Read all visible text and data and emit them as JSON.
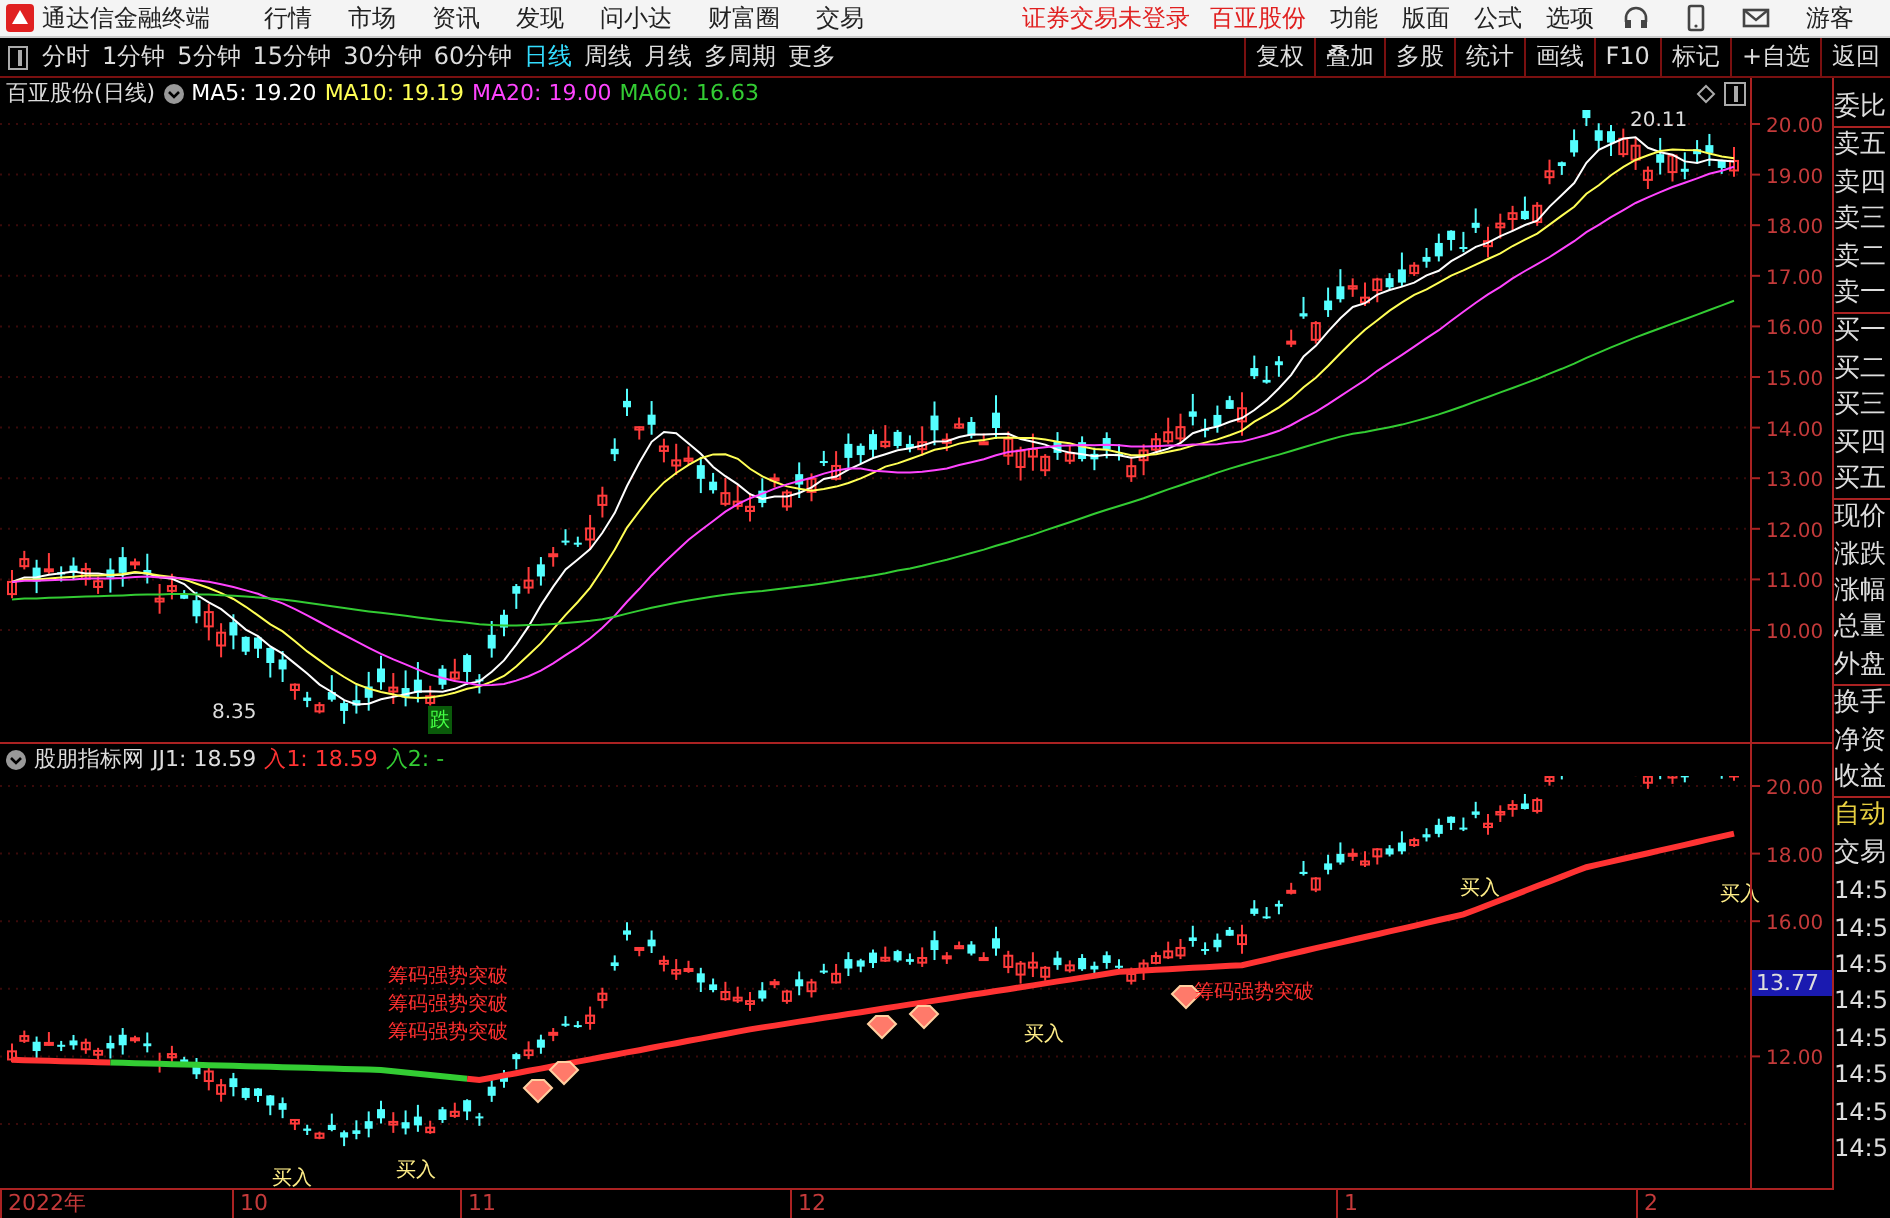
{
  "app": {
    "title": "通达信金融终端"
  },
  "menu": [
    "行情",
    "市场",
    "资讯",
    "发现",
    "问小达",
    "财富圈",
    "交易"
  ],
  "status": [
    "证券交易未登录",
    "百亚股份"
  ],
  "right_menu": [
    "功能",
    "版面",
    "公式",
    "选项"
  ],
  "user": "游客",
  "periods": [
    {
      "label": "分时",
      "selected": false
    },
    {
      "label": "1分钟",
      "selected": false
    },
    {
      "label": "5分钟",
      "selected": false
    },
    {
      "label": "15分钟",
      "selected": false
    },
    {
      "label": "30分钟",
      "selected": false
    },
    {
      "label": "60分钟",
      "selected": false
    },
    {
      "label": "日线",
      "selected": true
    },
    {
      "label": "周线",
      "selected": false
    },
    {
      "label": "月线",
      "selected": false
    },
    {
      "label": "多周期",
      "selected": false
    },
    {
      "label": "更多",
      "selected": false
    }
  ],
  "tools": [
    "复权",
    "叠加",
    "多股",
    "统计",
    "画线",
    "F10",
    "标记",
    "+自选",
    "返回"
  ],
  "main_chart": {
    "title": "百亚股份(日线)",
    "ma": [
      {
        "name": "MA5: 19.20",
        "color": "#ffffff"
      },
      {
        "name": "MA10: 19.19",
        "color": "#ffff55"
      },
      {
        "name": "MA20: 19.00",
        "color": "#ff44ff"
      },
      {
        "name": "MA60: 16.63",
        "color": "#33cc33"
      }
    ],
    "y_labels": [
      "20.00",
      "19.00",
      "18.00",
      "17.00",
      "16.00",
      "15.00",
      "14.00",
      "13.00",
      "12.00",
      "11.00",
      "10.00"
    ],
    "annotations": [
      {
        "kind": "high",
        "text": "20.11"
      },
      {
        "kind": "low",
        "text": "8.35"
      },
      {
        "kind": "signal",
        "text": "跌"
      }
    ]
  },
  "indicator": {
    "name": "股朋指标网",
    "values": [
      {
        "label": "JJ1: 18.59",
        "color": "#dddddd"
      },
      {
        "label": "入1: 18.59",
        "color": "#ff3333"
      },
      {
        "label": "入2: -",
        "color": "#33cc33"
      }
    ],
    "y_labels": [
      "20.00",
      "18.00",
      "16.00",
      "12.00"
    ],
    "cursor_value": "13.77",
    "annotations": [
      {
        "kind": "buy",
        "text": "买入"
      },
      {
        "kind": "buy",
        "text": "买入"
      },
      {
        "kind": "buy",
        "text": "买入"
      },
      {
        "kind": "buy",
        "text": "买入"
      },
      {
        "kind": "buy",
        "text": "买入"
      },
      {
        "kind": "breakout",
        "text": "筹码强势突破"
      },
      {
        "kind": "breakout",
        "text": "筹码强势突破"
      },
      {
        "kind": "breakout",
        "text": "筹码强势突破"
      },
      {
        "kind": "breakout",
        "text": "筹码强势突破"
      }
    ]
  },
  "x_labels": [
    "2022年",
    "10",
    "11",
    "12",
    "1",
    "2"
  ],
  "quote_panel": [
    "委比",
    "卖五",
    "卖四",
    "卖三",
    "卖二",
    "卖一",
    "买一",
    "买二",
    "买三",
    "买四",
    "买五",
    "现价",
    "涨跌",
    "涨幅",
    "总量",
    "外盘",
    "换手",
    "净资",
    "收益"
  ],
  "trade": [
    "自动",
    "交易"
  ],
  "time_list": [
    "14:5",
    "14:5",
    "14:5",
    "14:5",
    "14:5",
    "14:5",
    "14:5",
    "14:5"
  ]
}
